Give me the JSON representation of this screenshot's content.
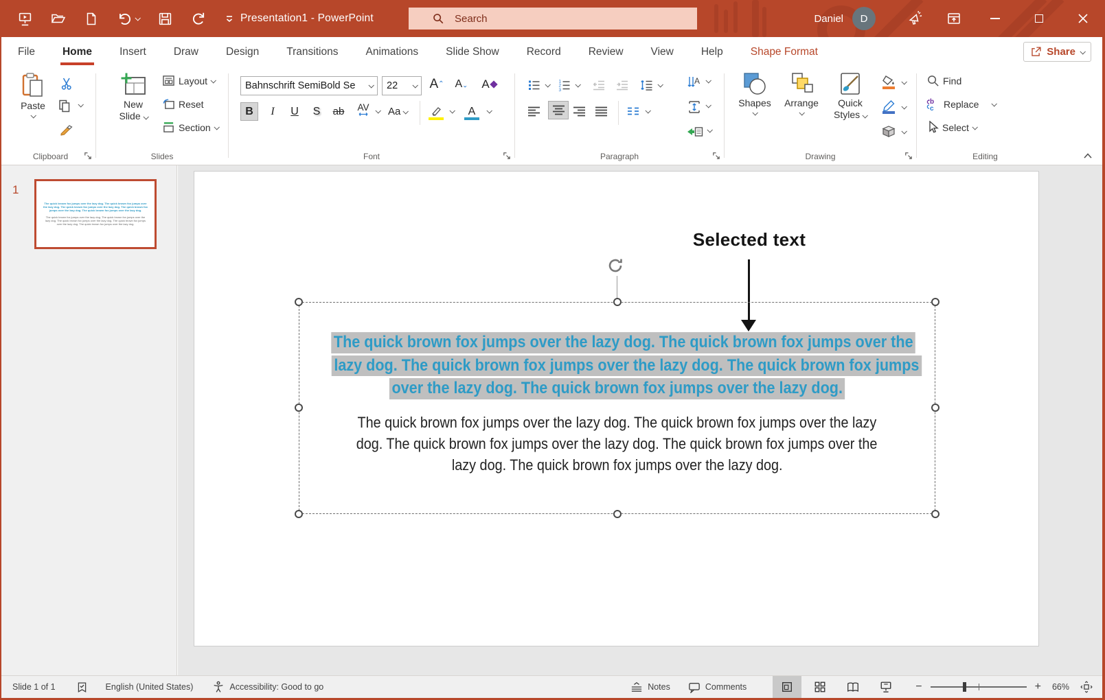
{
  "titlebar": {
    "title": "Presentation1  -  PowerPoint",
    "search_placeholder": "Search",
    "user_name": "Daniel",
    "user_initial": "D"
  },
  "tabs": {
    "items": [
      {
        "label": "File"
      },
      {
        "label": "Home"
      },
      {
        "label": "Insert"
      },
      {
        "label": "Draw"
      },
      {
        "label": "Design"
      },
      {
        "label": "Transitions"
      },
      {
        "label": "Animations"
      },
      {
        "label": "Slide Show"
      },
      {
        "label": "Record"
      },
      {
        "label": "Review"
      },
      {
        "label": "View"
      },
      {
        "label": "Help"
      },
      {
        "label": "Shape Format"
      }
    ],
    "active_tab": "Home",
    "share_label": "Share"
  },
  "ribbon": {
    "clipboard": {
      "label": "Clipboard",
      "paste": "Paste"
    },
    "slides": {
      "label": "Slides",
      "new_slide_1": "New",
      "new_slide_2": "Slide",
      "layout": "Layout",
      "reset": "Reset",
      "section": "Section"
    },
    "font": {
      "label": "Font",
      "name": "Bahnschrift SemiBold Se",
      "size": "22",
      "bold": "B",
      "italic": "I",
      "underline": "U",
      "shadow": "S",
      "strikethrough": "ab",
      "char_spacing": "AV",
      "change_case": "Aa",
      "grow": "A",
      "shrink": "A",
      "clear": "A",
      "color": "A"
    },
    "paragraph": {
      "label": "Paragraph"
    },
    "drawing": {
      "label": "Drawing",
      "shapes": "Shapes",
      "arrange": "Arrange",
      "quick_styles_1": "Quick",
      "quick_styles_2": "Styles"
    },
    "editing": {
      "label": "Editing",
      "find": "Find",
      "replace": "Replace",
      "select": "Select"
    }
  },
  "slide_panel": {
    "slide_number": "1"
  },
  "slide": {
    "annotation": "Selected text",
    "selected_lines": [
      "The quick brown fox jumps over the lazy dog. The quick brown fox jumps over the",
      "lazy dog. The quick brown fox jumps over the lazy dog. The quick brown fox jumps",
      "over the lazy dog. The quick brown fox jumps over the lazy dog."
    ],
    "normal_lines": [
      "The quick brown fox jumps over the lazy dog. The quick brown fox jumps over the lazy",
      "dog. The quick brown fox jumps over the lazy dog. The quick brown fox jumps over the",
      "lazy dog. The quick brown fox jumps over the lazy dog."
    ]
  },
  "statusbar": {
    "slide_indicator": "Slide 1 of 1",
    "language": "English (United States)",
    "accessibility": "Accessibility: Good to go",
    "notes": "Notes",
    "comments": "Comments",
    "zoom_level": "66%"
  },
  "colors": {
    "brand_red": "#B7472A",
    "selected_text_blue": "#2E9BC6",
    "selection_highlight_gray": "#BFBFBF",
    "accent_blue": "#2B7CD3"
  }
}
